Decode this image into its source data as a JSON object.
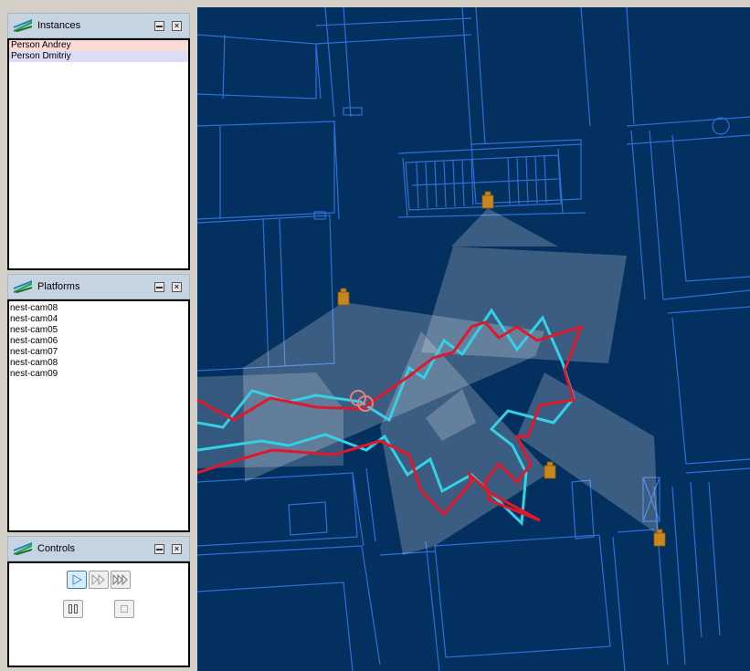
{
  "panels": {
    "instances": {
      "title": "Instances",
      "items": [
        {
          "label": "Person Andrey",
          "color": "#fadbd8"
        },
        {
          "label": "Person Dmitriy",
          "color": "#dcdcf7"
        }
      ]
    },
    "platforms": {
      "title": "Platforms",
      "items": [
        "nest-cam08",
        "nest-cam04",
        "nest-cam05",
        "nest-cam06",
        "nest-cam07",
        "nest-cam08",
        "nest-cam09"
      ]
    },
    "controls": {
      "title": "Controls",
      "buttons": [
        "play",
        "fast-forward",
        "faster-forward",
        "pause",
        "stop"
      ]
    }
  },
  "map": {
    "background": "#03305e",
    "floorplan_color": "#2f6fd6",
    "camera_color": "#c8861e",
    "tracks": [
      {
        "person": "Person Andrey",
        "color": "#e0182c"
      },
      {
        "person": "Person Dmitriy",
        "color": "#33d1e6"
      }
    ]
  }
}
